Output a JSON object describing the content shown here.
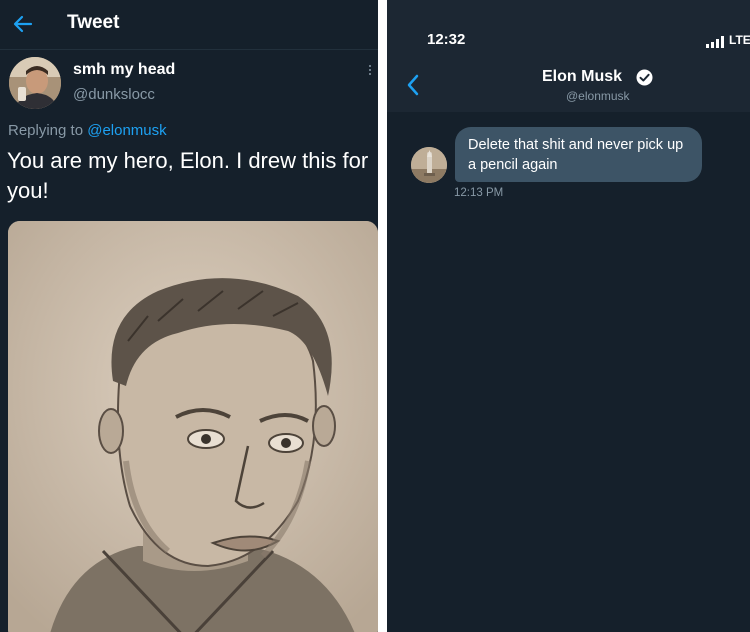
{
  "left": {
    "header": {
      "title": "Tweet",
      "back_icon": "back-arrow-icon"
    },
    "author": {
      "name": "smh my head",
      "handle": "@dunkslocc",
      "more_icon": "more-vertical-icon"
    },
    "replying": {
      "prefix": "Replying to ",
      "mention": "@elonmusk"
    },
    "tweet_text": "You are my hero, Elon. I drew this for you!",
    "colors": {
      "background": "#15202b",
      "text": "#ffffff",
      "muted": "#8899a6",
      "accent": "#1da1f2"
    }
  },
  "right": {
    "status": {
      "time": "12:32",
      "network": "LTE",
      "signal_icon": "signal-bars-icon"
    },
    "header": {
      "name": "Elon Musk",
      "handle": "@elonmusk",
      "verified_icon": "verified-badge-icon",
      "back_icon": "chevron-left-icon"
    },
    "message": {
      "text": "Delete that shit and never pick up a pencil again",
      "time": "12:13 PM"
    },
    "colors": {
      "background": "#15202b",
      "bubble": "#3d5466",
      "accent": "#1da1f2"
    }
  }
}
